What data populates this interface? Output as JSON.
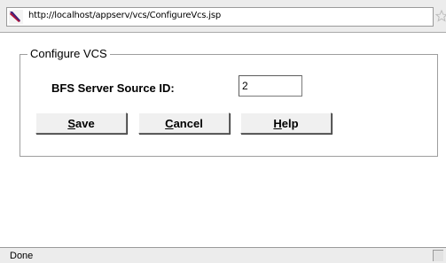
{
  "browser": {
    "url": "http://localhost/appserv/vcs/ConfigureVcs.jsp",
    "site_icon": "feather-icon",
    "bookmark_icon": "star-icon"
  },
  "form": {
    "legend": "Configure VCS",
    "field_label": "BFS Server Source ID:",
    "field_value": "2",
    "buttons": {
      "save": {
        "accesskey": "S",
        "rest": "ave"
      },
      "cancel": {
        "accesskey": "C",
        "rest": "ancel"
      },
      "help": {
        "accesskey": "H",
        "rest": "elp"
      }
    }
  },
  "status": {
    "text": "Done"
  }
}
